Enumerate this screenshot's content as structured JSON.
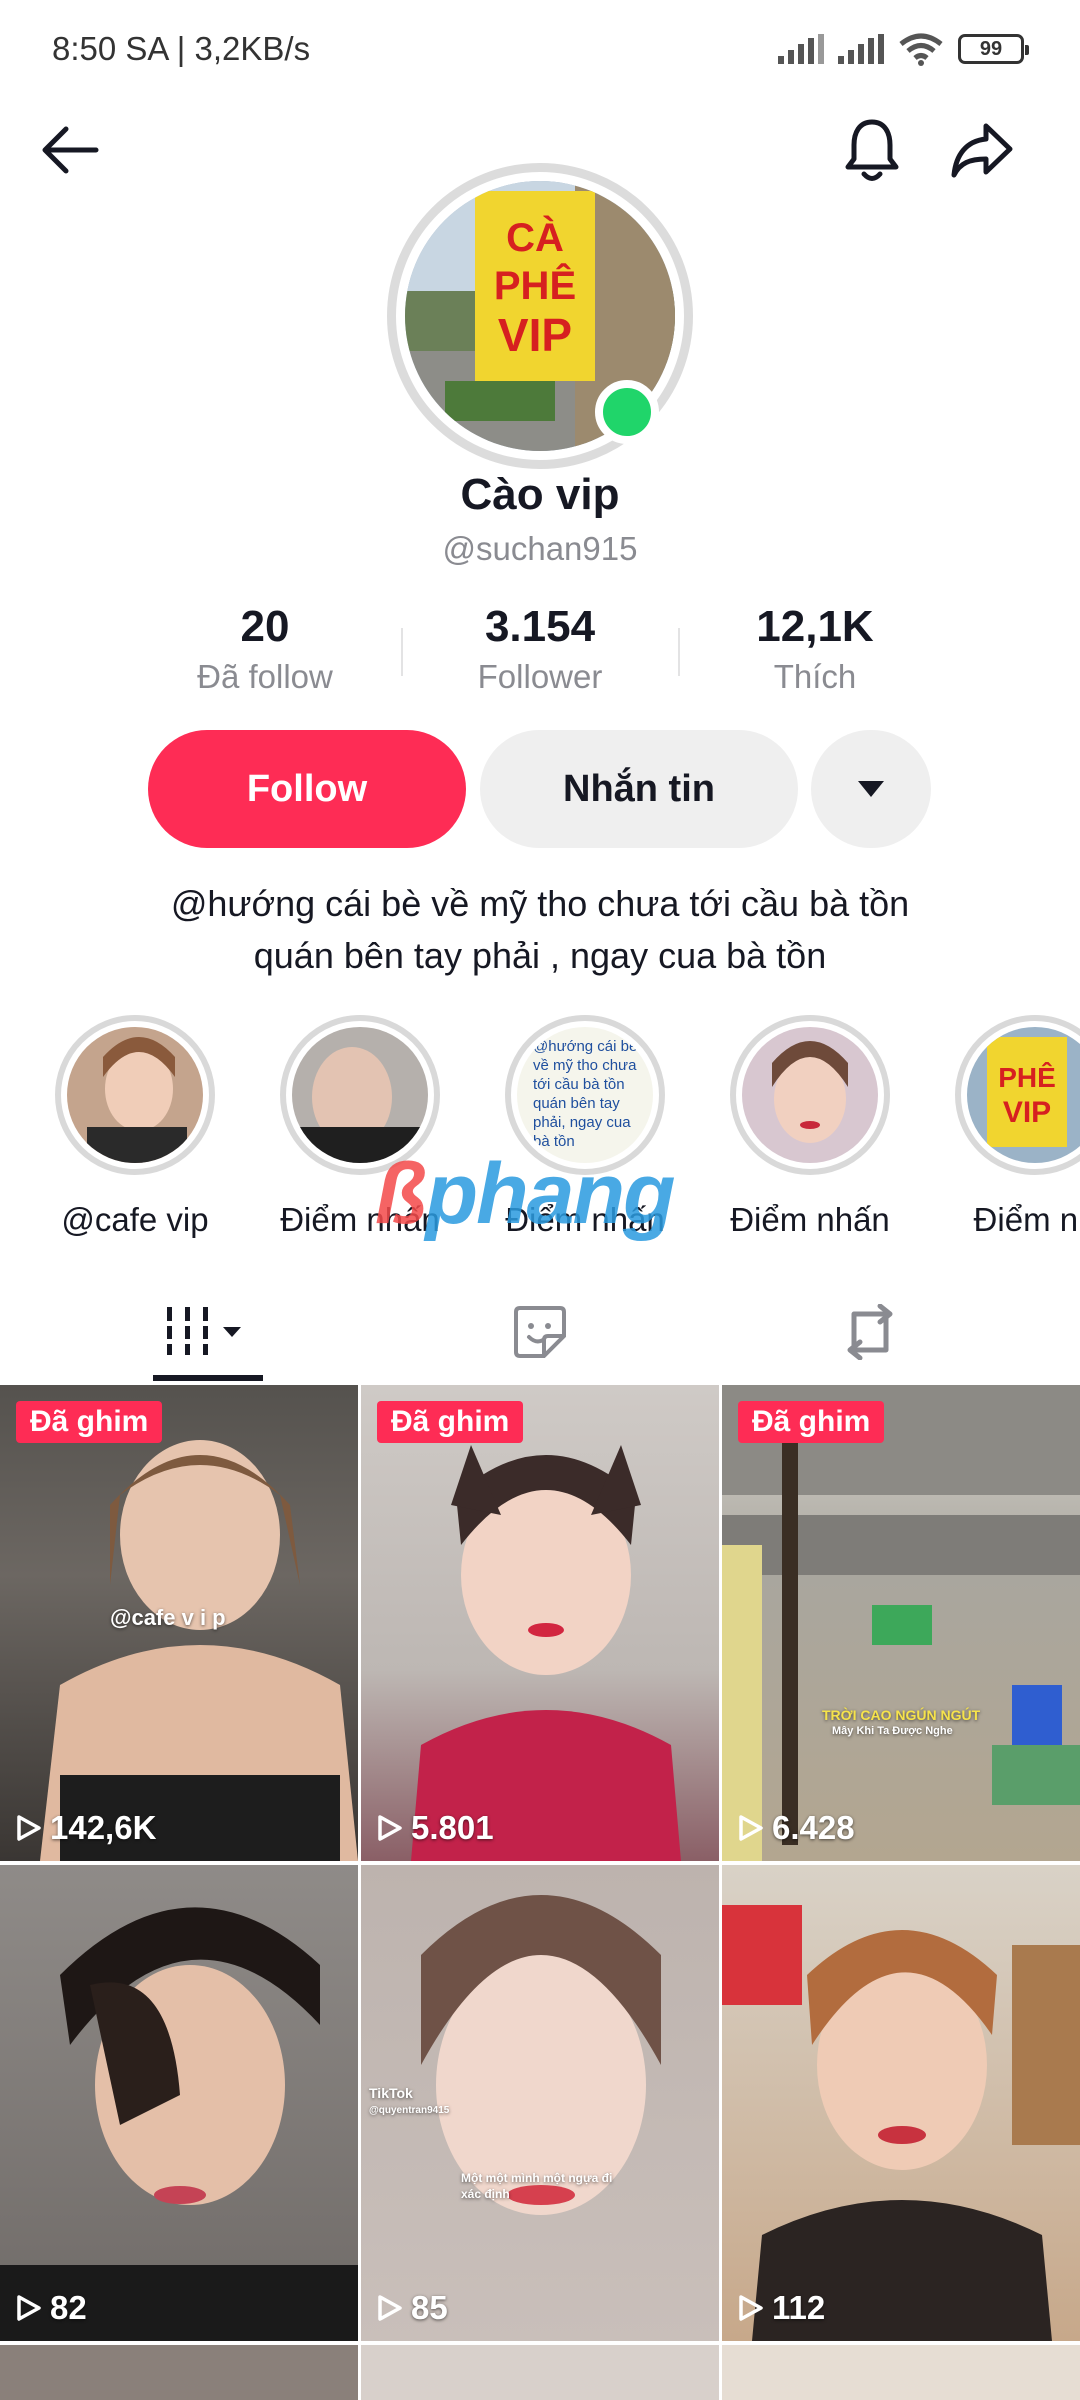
{
  "status_bar": {
    "time_speed": "8:50 SA | 3,2KB/s",
    "battery": "99"
  },
  "profile": {
    "avatar_sign_text": "CÀ PHÊ VIP",
    "name": "Cào vip",
    "handle": "@suchan915",
    "stats": [
      {
        "value": "20",
        "label": "Đã follow"
      },
      {
        "value": "3.154",
        "label": "Follower"
      },
      {
        "value": "12,1K",
        "label": "Thích"
      }
    ],
    "follow_label": "Follow",
    "message_label": "Nhắn tin",
    "bio_line1": "@hướng cái bè về mỹ tho chưa tới cầu bà tồn",
    "bio_line2": "quán bên tay phải , ngay cua bà tồn"
  },
  "highlights": [
    {
      "label": "@cafe vip"
    },
    {
      "label": "Điểm nhấn"
    },
    {
      "label": "Điểm nhấn",
      "thumb_text": "@hướng cái bè về mỹ tho chưa tới cầu bà tồn quán bên tay phải, ngay cua bà tồn"
    },
    {
      "label": "Điểm nhấn"
    },
    {
      "label": "Điểm nh"
    }
  ],
  "watermark": {
    "part_a": "ß",
    "part_b": "phang"
  },
  "tabs": [
    "videos-tab",
    "liked-tab",
    "reposts-tab"
  ],
  "videos": [
    {
      "pinned": "Đã ghim",
      "views": "142,6K",
      "overlay": "@cafe v i p"
    },
    {
      "pinned": "Đã ghim",
      "views": "5.801",
      "overlay": ""
    },
    {
      "pinned": "Đã ghim",
      "views": "6.428",
      "overlay": "TRỜI CAO NGÚN NGÚT",
      "overlay2": "Mây Khi Ta Được Nghe"
    },
    {
      "pinned": "",
      "views": "82",
      "overlay": ""
    },
    {
      "pinned": "",
      "views": "85",
      "overlay": "TikTok",
      "overlay2": "@quyentran9415",
      "overlay3": "Một một mình một ngựa đi xác định"
    },
    {
      "pinned": "",
      "views": "112",
      "overlay": ""
    }
  ],
  "colors": {
    "accent": "#fe2c55",
    "online": "#20d56a",
    "muted": "#8a8b91"
  }
}
